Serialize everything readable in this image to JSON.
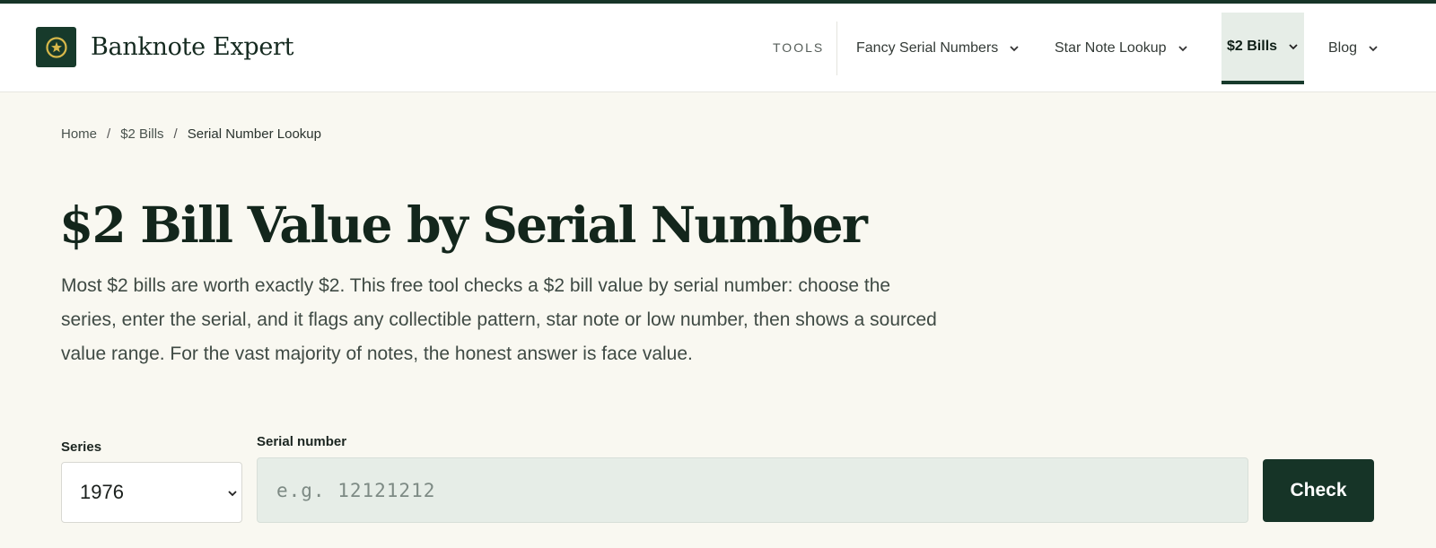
{
  "site": {
    "brand_name": "Banknote Expert",
    "accent_color": "#163427",
    "logo_icon": "star-coin-icon"
  },
  "nav": {
    "tools_label": "TOOLS",
    "items": [
      {
        "label": "Fancy Serial Numbers",
        "active": false
      },
      {
        "label": "Star Note Lookup",
        "active": false
      },
      {
        "label": "$2 Bills",
        "active": true
      },
      {
        "label": "Blog",
        "active": false
      }
    ]
  },
  "breadcrumb": {
    "items": [
      "Home",
      "$2 Bills",
      "Serial Number Lookup"
    ],
    "separator": "/"
  },
  "page": {
    "title": "$2 Bill Value by Serial Number",
    "lede": "Most $2 bills are worth exactly $2. This free tool checks a $2 bill value by serial number: choose the series, enter the serial, and it flags any collectible pattern, star note or low number, then shows a sourced value range. For the vast majority of notes, the honest answer is face value."
  },
  "form": {
    "series_label": "Series",
    "series_value": "1976",
    "serial_label": "Serial number",
    "serial_placeholder": "e.g. 12121212",
    "serial_value": "",
    "check_label": "Check"
  }
}
